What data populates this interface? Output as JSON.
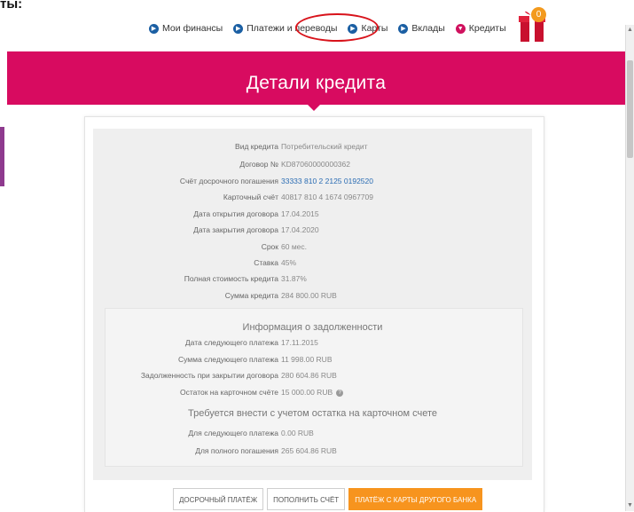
{
  "corner_fragment": "ты:",
  "nav": {
    "items": [
      {
        "label": "Мои финансы",
        "icon": "arrow-circle-icon"
      },
      {
        "label": "Платежи и переводы",
        "icon": "arrow-circle-icon"
      },
      {
        "label": "Карты",
        "icon": "arrow-circle-icon"
      },
      {
        "label": "Вклады",
        "icon": "arrow-circle-icon"
      },
      {
        "label": "Кредиты",
        "icon": "chevron-circle-icon"
      }
    ],
    "gift_badge": "0"
  },
  "banner": {
    "title": "Детали кредита"
  },
  "loan": {
    "rows": [
      {
        "label": "Вид кредита",
        "value": "Потребительский кредит"
      },
      {
        "label": "Договор №",
        "value": "KD87060000000362"
      },
      {
        "label": "Счёт досрочного погашения",
        "value": "33333 810 2 2125 0192520"
      },
      {
        "label": "Карточный счёт",
        "value": "40817 810 4 1674 0967709"
      },
      {
        "label": "Дата открытия договора",
        "value": "17.04.2015"
      },
      {
        "label": "Дата закрытия договора",
        "value": "17.04.2020"
      },
      {
        "label": "Срок",
        "value": "60 мес."
      },
      {
        "label": "Ставка",
        "value": "45%"
      },
      {
        "label": "Полная стоимость кредита",
        "value": "31.87%"
      },
      {
        "label": "Сумма кредита",
        "value": "284 800.00 RUB"
      }
    ]
  },
  "debt": {
    "title": "Информация о задолженности",
    "rows": [
      {
        "label": "Дата следующего платежа",
        "value": "17.11.2015"
      },
      {
        "label": "Сумма следующего платежа",
        "value": "11 998.00 RUB"
      },
      {
        "label": "Задолженность при закрытии договора",
        "value": "280 604.86 RUB"
      },
      {
        "label": "Остаток на карточном счёте",
        "value": "15 000.00 RUB"
      }
    ],
    "required_title": "Требуется внести с учетом остатка на карточном счете",
    "required_rows": [
      {
        "label": "Для следующего платежа",
        "value": "0.00 RUB"
      },
      {
        "label": "Для полного погашения",
        "value": "265 604.86 RUB"
      }
    ]
  },
  "buttons": {
    "early_payment": "ДОСРОЧНЫЙ ПЛАТЁЖ",
    "top_up": "ПОПОЛНИТЬ СЧЁТ",
    "other_bank": "ПЛАТЁЖ С КАРТЫ ДРУГОГО БАНКА"
  },
  "colors": {
    "brand": "#d80b60",
    "accent": "#f7941e",
    "link": "#2a6cb3",
    "annotation": "#d8131b"
  }
}
